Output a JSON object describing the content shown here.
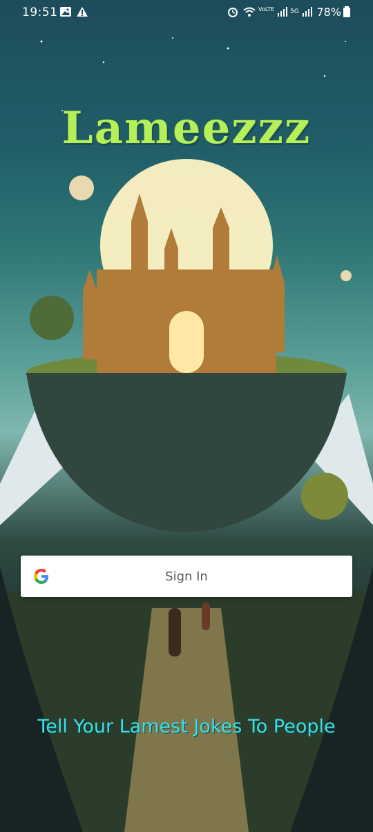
{
  "status_bar": {
    "time": "19:51",
    "network_1": "VoLTE1",
    "network_2": "5G",
    "battery": "78%"
  },
  "app": {
    "title": "Lameezzz",
    "tagline": "Tell Your Lamest Jokes To People"
  },
  "signin_button": {
    "label": "Sign In",
    "icon": "google-logo"
  },
  "colors": {
    "title": "#b5f05a",
    "tagline": "#3ce0e6",
    "button_bg": "#ffffff"
  }
}
